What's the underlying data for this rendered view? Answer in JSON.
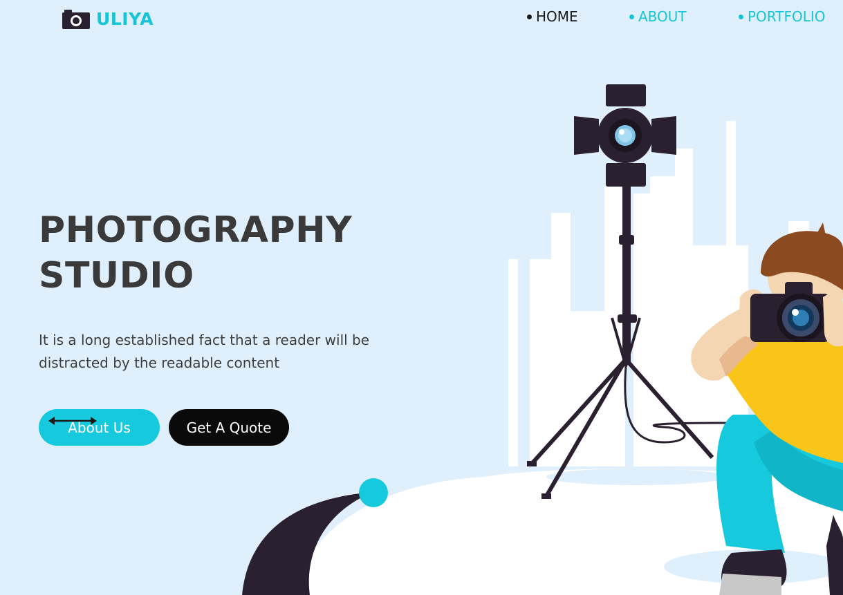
{
  "brand": {
    "name": "ULIYA",
    "icon": "camera-icon",
    "color": "#17c5d6"
  },
  "nav": {
    "items": [
      {
        "label": "HOME",
        "color": "#1a1a1a"
      },
      {
        "label": "ABOUT",
        "color": "#17c5d6"
      },
      {
        "label": "PORTFOLIO",
        "color": "#17c5d6"
      }
    ]
  },
  "hero": {
    "title_line1": "PHOTOGRAPHY",
    "title_line2": "STUDIO",
    "description": "It is a long established fact that a reader will be distracted by the readable content",
    "primary_button": "About Us",
    "secondary_button": "Get A Quote",
    "arrow_icon": "double-arrow-icon"
  },
  "colors": {
    "background": "#dfeffb",
    "accent": "#17c9dc",
    "dark": "#2b2030",
    "title": "#3a3a3a"
  },
  "illustration": {
    "subject": "photographer-with-camera-and-studio-light",
    "icons": [
      "studio-light-icon",
      "tripod-icon",
      "photographer-icon",
      "city-skyline-icon"
    ]
  }
}
